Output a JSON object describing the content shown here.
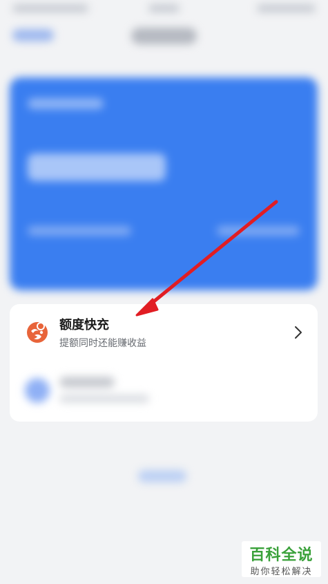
{
  "feature": {
    "title": "额度快充",
    "subtitle": "提额同时还能赚收益",
    "icon": "quick-charge-logo-icon",
    "icon_color": "#e8643a"
  },
  "arrow_color": "#e11d23",
  "accent_blue": "#3a7ef0",
  "watermark": {
    "title": "百科全说",
    "subtitle": "助你轻松解决"
  }
}
